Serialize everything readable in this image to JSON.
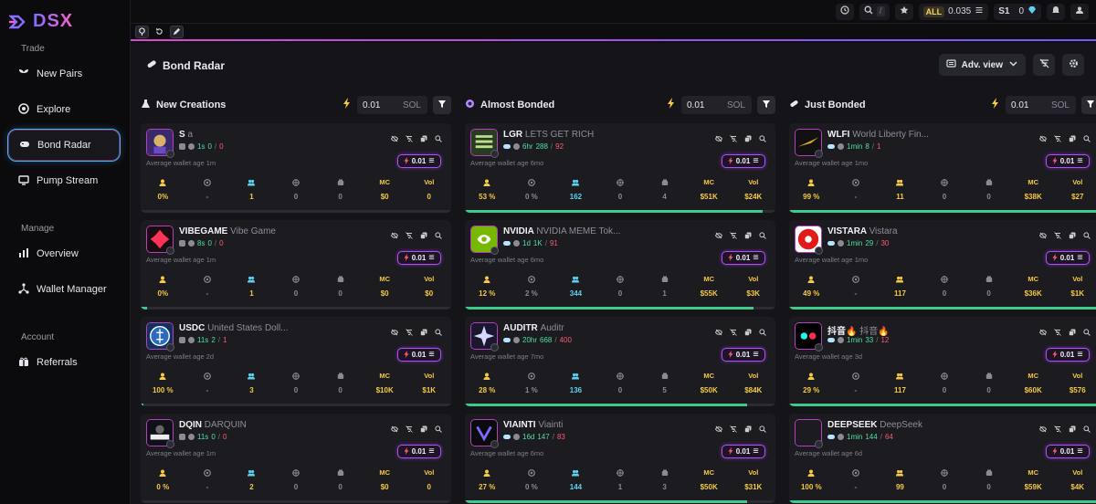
{
  "brand": "DSX",
  "sidebar": {
    "sections": [
      {
        "label": "Trade",
        "items": [
          {
            "label": "New Pairs",
            "icon": "sprout-icon"
          },
          {
            "label": "Explore",
            "icon": "compass-icon"
          },
          {
            "label": "Bond Radar",
            "icon": "gamepad-icon",
            "active": true
          },
          {
            "label": "Pump Stream",
            "icon": "monitor-icon"
          }
        ]
      },
      {
        "label": "Manage",
        "items": [
          {
            "label": "Overview",
            "icon": "bar-chart-icon"
          },
          {
            "label": "Wallet Manager",
            "icon": "network-icon"
          }
        ]
      },
      {
        "label": "Account",
        "items": [
          {
            "label": "Referrals",
            "icon": "gift-icon"
          }
        ]
      }
    ]
  },
  "topbar": {
    "search_shortcut": "/",
    "all_badge": "ALL",
    "balance": "0.035",
    "wallet_label": "S1",
    "wallet_value": "0"
  },
  "page": {
    "title": "Bond Radar",
    "view_label": "Adv. view"
  },
  "columns": [
    {
      "name": "New Creations",
      "amount": "0.01",
      "unit": "SOL",
      "cards": [
        {
          "symbol": "S",
          "name": "a",
          "age": "1s",
          "holders": "0",
          "r": "0",
          "avg_age": "Average wallet age 1m",
          "buy": "0.01",
          "top": "0%",
          "dev": "-",
          "holders_stat": "1",
          "snipers": "0",
          "bundlers": "0",
          "mc": "$0",
          "vol": "0",
          "progress": 0.0
        },
        {
          "symbol": "VIBEGAME",
          "name": "Vibe Game",
          "age": "8s",
          "holders": "0",
          "r": "0",
          "avg_age": "Average wallet age 1m",
          "buy": "0.01",
          "top": "0%",
          "dev": "-",
          "holders_stat": "1",
          "snipers": "0",
          "bundlers": "0",
          "mc": "$0",
          "vol": "$0",
          "progress": 0.02
        },
        {
          "symbol": "USDC",
          "name": "United States Doll...",
          "age": "11s",
          "holders": "2",
          "r": "1",
          "avg_age": "Average wallet age 2d",
          "buy": "0.01",
          "top": "100 %",
          "dev": "-",
          "holders_stat": "3",
          "snipers": "0",
          "bundlers": "0",
          "mc": "$10K",
          "vol": "$1K",
          "progress": 0.01
        },
        {
          "symbol": "DQIN",
          "name": "DARQUIN",
          "age": "11s",
          "holders": "0",
          "r": "0",
          "avg_age": "Average wallet age 1m",
          "buy": "0.01",
          "top": "0 %",
          "dev": "-",
          "holders_stat": "2",
          "snipers": "0",
          "bundlers": "0",
          "mc": "$0",
          "vol": "0",
          "progress": 0.0
        }
      ]
    },
    {
      "name": "Almost Bonded",
      "amount": "0.01",
      "unit": "SOL",
      "cards": [
        {
          "symbol": "LGR",
          "name": "LETS GET RICH",
          "age": "6hr",
          "holders": "288",
          "r": "92",
          "avg_age": "Average wallet age 6mo",
          "buy": "0.01",
          "top": "53 %",
          "dev": "0 %",
          "holders_stat": "162",
          "snipers": "0",
          "bundlers": "4",
          "mc": "$51K",
          "vol": "$24K",
          "progress": 0.96
        },
        {
          "symbol": "NVIDIA",
          "name": "NVIDIA MEME Tok...",
          "age": "1d",
          "holders": "1K",
          "r": "91",
          "avg_age": "Average wallet age 6mo",
          "buy": "0.01",
          "top": "12 %",
          "dev": "2 %",
          "holders_stat": "344",
          "snipers": "0",
          "bundlers": "1",
          "mc": "$55K",
          "vol": "$3K",
          "progress": 0.93
        },
        {
          "symbol": "AUDITR",
          "name": "Auditr",
          "age": "20hr",
          "holders": "668",
          "r": "400",
          "avg_age": "Average wallet age 7mo",
          "buy": "0.01",
          "top": "28 %",
          "dev": "1 %",
          "holders_stat": "136",
          "snipers": "0",
          "bundlers": "5",
          "mc": "$50K",
          "vol": "$84K",
          "progress": 0.91
        },
        {
          "symbol": "VIAINTI",
          "name": "Viainti",
          "age": "16d",
          "holders": "147",
          "r": "83",
          "avg_age": "Average wallet age 6mo",
          "buy": "0.01",
          "top": "27 %",
          "dev": "0 %",
          "holders_stat": "144",
          "snipers": "1",
          "bundlers": "3",
          "mc": "$50K",
          "vol": "$31K",
          "progress": 0.91
        }
      ]
    },
    {
      "name": "Just Bonded",
      "amount": "0.01",
      "unit": "SOL",
      "cards": [
        {
          "symbol": "WLFI",
          "name": "World Liberty Fin...",
          "age": "1min",
          "holders": "8",
          "r": "1",
          "avg_age": "Average wallet age 1mo",
          "buy": "0.01",
          "top": "99 %",
          "dev": "-",
          "holders_stat": "11",
          "snipers": "0",
          "bundlers": "0",
          "mc": "$38K",
          "vol": "$27",
          "progress": 1.0
        },
        {
          "symbol": "VISTARA",
          "name": "Vistara",
          "age": "1min",
          "holders": "29",
          "r": "30",
          "avg_age": "Average wallet age 1mo",
          "buy": "0.01",
          "top": "49 %",
          "dev": "-",
          "holders_stat": "117",
          "snipers": "0",
          "bundlers": "0",
          "mc": "$36K",
          "vol": "$1K",
          "progress": 1.0
        },
        {
          "symbol": "抖音🔥",
          "name": "抖音🔥",
          "age": "1min",
          "holders": "33",
          "r": "12",
          "avg_age": "Average wallet age 3d",
          "buy": "0.01",
          "top": "29 %",
          "dev": "-",
          "holders_stat": "117",
          "snipers": "0",
          "bundlers": "0",
          "mc": "$60K",
          "vol": "$576",
          "progress": 1.0
        },
        {
          "symbol": "DEEPSEEK",
          "name": "DeepSeek",
          "age": "1min",
          "holders": "144",
          "r": "64",
          "avg_age": "Average wallet age 6d",
          "buy": "0.01",
          "top": "100 %",
          "dev": "-",
          "holders_stat": "99",
          "snipers": "0",
          "bundlers": "0",
          "mc": "$59K",
          "vol": "$4K",
          "progress": 1.0
        }
      ]
    }
  ],
  "stat_labels": {
    "mc": "MC",
    "vol": "Vol"
  },
  "colors": {
    "accent_pink": "#d64ad0",
    "accent_blue": "#43b8ff",
    "progress": "#40c98c",
    "yellow": "#f6c946",
    "cyan": "#5fd0f0"
  }
}
